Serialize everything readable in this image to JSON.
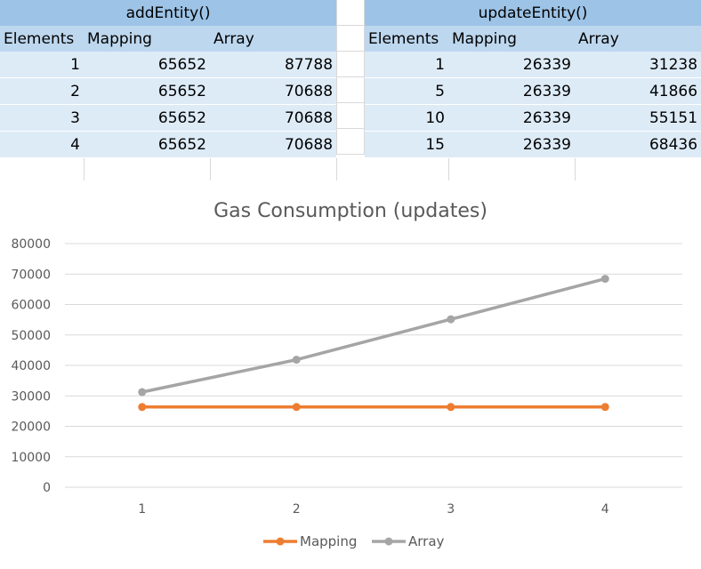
{
  "tables": [
    {
      "title": "addEntity()",
      "headers": [
        "Elements",
        "Mapping",
        "Array"
      ],
      "rows": [
        [
          "1",
          "65652",
          "87788"
        ],
        [
          "2",
          "65652",
          "70688"
        ],
        [
          "3",
          "65652",
          "70688"
        ],
        [
          "4",
          "65652",
          "70688"
        ]
      ]
    },
    {
      "title": "updateEntity()",
      "headers": [
        "Elements",
        "Mapping",
        "Array"
      ],
      "rows": [
        [
          "1",
          "26339",
          "31238"
        ],
        [
          "5",
          "26339",
          "41866"
        ],
        [
          "10",
          "26339",
          "55151"
        ],
        [
          "15",
          "26339",
          "68436"
        ]
      ]
    }
  ],
  "chart_data": {
    "type": "line",
    "title": "Gas Consumption (updates)",
    "categories": [
      "1",
      "2",
      "3",
      "4"
    ],
    "series": [
      {
        "name": "Mapping",
        "color": "#ed7d31",
        "values": [
          26339,
          26339,
          26339,
          26339
        ]
      },
      {
        "name": "Array",
        "color": "#a5a5a5",
        "values": [
          31238,
          41866,
          55151,
          68436
        ]
      }
    ],
    "ylim": [
      0,
      80000
    ],
    "yticks": [
      "0",
      "10000",
      "20000",
      "30000",
      "40000",
      "50000",
      "60000",
      "70000",
      "80000"
    ],
    "grid": true,
    "legend": "bottom",
    "xlabel": "",
    "ylabel": ""
  }
}
